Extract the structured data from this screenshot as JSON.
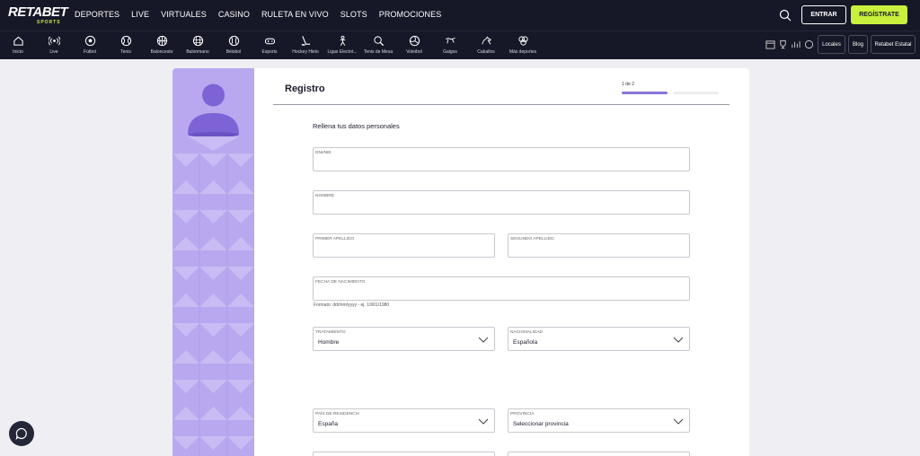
{
  "brand": {
    "name": "RETABET",
    "sub": "SPORTS"
  },
  "main_nav": [
    "DEPORTES",
    "LIVE",
    "VIRTUALES",
    "CASINO",
    "RULETA EN VIVO",
    "SLOTS",
    "PROMOCIONES"
  ],
  "auth": {
    "login_label": "ENTRAR",
    "register_label": "REGÍSTRATE"
  },
  "sports": [
    {
      "label": "Inicio",
      "icon": "home-icon"
    },
    {
      "label": "Live",
      "icon": "live-icon"
    },
    {
      "label": "Fútbol",
      "icon": "soccer-ball-icon"
    },
    {
      "label": "Tenis",
      "icon": "tennis-ball-icon"
    },
    {
      "label": "Baloncesto",
      "icon": "basketball-icon"
    },
    {
      "label": "Balonmano",
      "icon": "handball-icon"
    },
    {
      "label": "Béisbol",
      "icon": "baseball-icon"
    },
    {
      "label": "Esports",
      "icon": "gamepad-icon"
    },
    {
      "label": "Hockey Hielo",
      "icon": "hockey-icon"
    },
    {
      "label": "Ligas Electró...",
      "icon": "e-league-icon"
    },
    {
      "label": "Tenis de Mesa",
      "icon": "table-tennis-icon"
    },
    {
      "label": "Voleibol",
      "icon": "volleyball-icon"
    },
    {
      "label": "Galgos",
      "icon": "greyhound-icon"
    },
    {
      "label": "Caballos",
      "icon": "horse-icon"
    },
    {
      "label": "Más deportes",
      "icon": "more-sports-icon"
    }
  ],
  "utility": {
    "locales": "Locales",
    "blog": "Blog",
    "estatal": "Retabet Estatal"
  },
  "form": {
    "title": "Registro",
    "step": "1 de 2",
    "progress": 0.5,
    "subtitle": "Rellena tus datos personales",
    "dni_label": "DNI/NIE",
    "nombre_label": "NOMBRE",
    "primer_apellido_label": "PRIMER APELLIDO",
    "segundo_apellido_label": "SEGUNDO APELLIDO",
    "fecha_label": "FECHA DE NACIMIENTO",
    "fecha_hint": "Formato: dd/mm/yyyy - ej. 10/01/1980",
    "tratamiento_label": "TRATAMIENTO",
    "tratamiento_value": "Hombre",
    "nacionalidad_label": "NACIONALIDAD",
    "nacionalidad_value": "Española",
    "pais_label": "PAÍS DE RESIDENCIA",
    "pais_value": "España",
    "provincia_label": "PROVINCIA",
    "provincia_value": "Seleccionar provincia"
  },
  "colors": {
    "header_bg": "#161827",
    "accent": "#c8f03c",
    "purple": "#8a73d8",
    "side_panel": "#b9a8ef"
  }
}
